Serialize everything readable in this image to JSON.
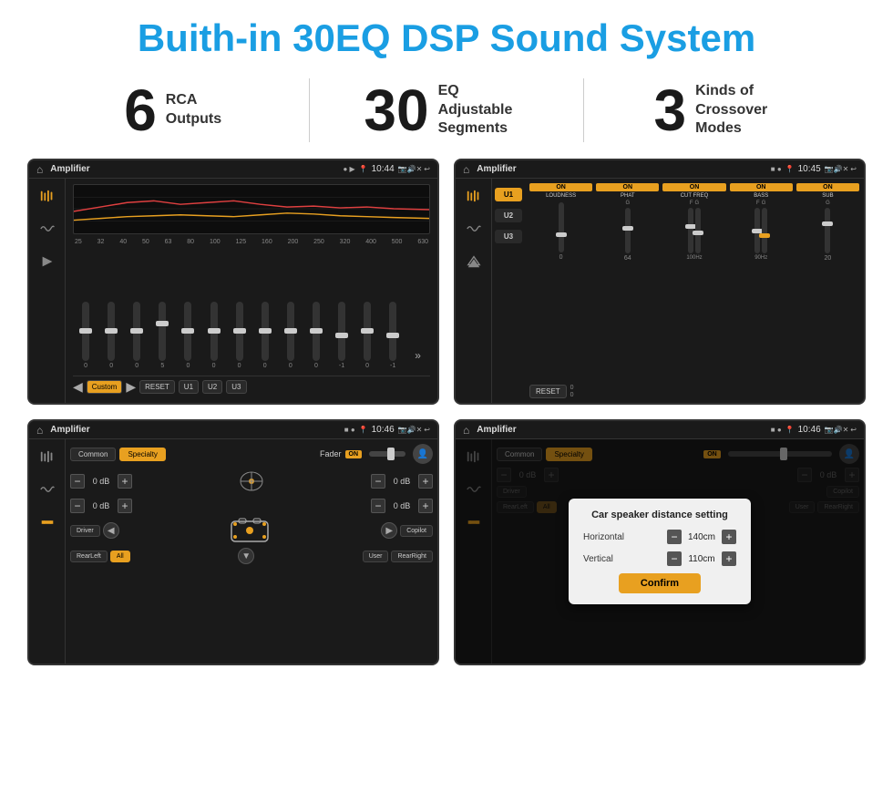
{
  "header": {
    "title": "Buith-in 30EQ DSP Sound System"
  },
  "stats": [
    {
      "number": "6",
      "label": "RCA\nOutputs"
    },
    {
      "number": "30",
      "label": "EQ Adjustable\nSegments"
    },
    {
      "number": "3",
      "label": "Kinds of\nCrossover Modes"
    }
  ],
  "screens": [
    {
      "id": "eq",
      "title": "Amplifier",
      "time": "10:44",
      "freqs": [
        "25",
        "32",
        "40",
        "50",
        "63",
        "80",
        "100",
        "125",
        "160",
        "200",
        "250",
        "320",
        "400",
        "500",
        "630"
      ],
      "slider_values": [
        "0",
        "0",
        "0",
        "5",
        "0",
        "0",
        "0",
        "0",
        "0",
        "0",
        "-1",
        "0",
        "-1"
      ],
      "buttons": [
        "Custom",
        "RESET",
        "U1",
        "U2",
        "U3"
      ]
    },
    {
      "id": "crossover",
      "title": "Amplifier",
      "time": "10:45",
      "presets": [
        "U1",
        "U2",
        "U3"
      ],
      "channels": [
        {
          "toggle": "ON",
          "label": "LOUDNESS"
        },
        {
          "toggle": "ON",
          "label": "PHAT"
        },
        {
          "toggle": "ON",
          "label": "CUT FREQ"
        },
        {
          "toggle": "ON",
          "label": "BASS"
        },
        {
          "toggle": "ON",
          "label": "SUB"
        }
      ],
      "reset_label": "RESET"
    },
    {
      "id": "fader",
      "title": "Amplifier",
      "time": "10:46",
      "tabs": [
        "Common",
        "Specialty"
      ],
      "fader_label": "Fader",
      "fader_on": "ON",
      "db_rows": [
        {
          "left": "— 0 dB +",
          "right": "— 0 dB +"
        },
        {
          "left": "— 0 dB +",
          "right": "— 0 dB +"
        }
      ],
      "bottom_buttons": [
        "Driver",
        "Copilot",
        "RearLeft",
        "All",
        "User",
        "RearRight"
      ]
    },
    {
      "id": "dialog",
      "title": "Amplifier",
      "time": "10:46",
      "tabs": [
        "Common",
        "Specialty"
      ],
      "dialog": {
        "title": "Car speaker distance setting",
        "horizontal_label": "Horizontal",
        "horizontal_value": "140cm",
        "vertical_label": "Vertical",
        "vertical_value": "110cm",
        "confirm_label": "Confirm"
      },
      "bottom_buttons": [
        "Driver",
        "Copilot",
        "RearLeft",
        "All",
        "User",
        "RearRight"
      ]
    }
  ]
}
